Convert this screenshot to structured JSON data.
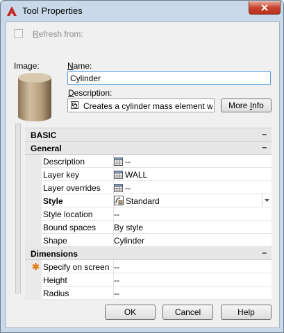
{
  "window": {
    "title": "Tool Properties"
  },
  "refresh": {
    "label_hotkey": "R",
    "label_rest": "efresh from:",
    "checked": false
  },
  "image": {
    "label": "Image:"
  },
  "name": {
    "label_hotkey": "N",
    "label_rest": "ame:",
    "value": "Cylinder"
  },
  "description": {
    "label_hotkey": "D",
    "label_rest": "escription:",
    "value": "Creates a cylinder mass element wit",
    "more_button_main": "More ",
    "more_button_hotkey": "I",
    "more_button_rest": "nfo"
  },
  "properties": {
    "basic": {
      "label": "BASIC",
      "collapse": "–"
    },
    "general": {
      "label": "General",
      "collapse": "–",
      "rows": [
        {
          "name": "Description",
          "value": "--",
          "icon": "grid-icon"
        },
        {
          "name": "Layer key",
          "value": "WALL",
          "icon": "grid-icon"
        },
        {
          "name": "Layer overrides",
          "value": "--",
          "icon": "grid-icon"
        },
        {
          "name": "Style",
          "value": "Standard",
          "icon": "style-icon"
        },
        {
          "name": "Style location",
          "value": "--"
        },
        {
          "name": "Bound spaces",
          "value": "By style"
        },
        {
          "name": "Shape",
          "value": "Cylinder"
        }
      ]
    },
    "dimensions": {
      "label": "Dimensions",
      "collapse": "–",
      "rows": [
        {
          "name": "Specify on screen",
          "value": "--",
          "marker": "✱"
        },
        {
          "name": "Height",
          "value": "--"
        },
        {
          "name": "Radius",
          "value": "--"
        }
      ]
    }
  },
  "buttons": {
    "ok": "OK",
    "cancel": "Cancel",
    "help": "Help"
  }
}
